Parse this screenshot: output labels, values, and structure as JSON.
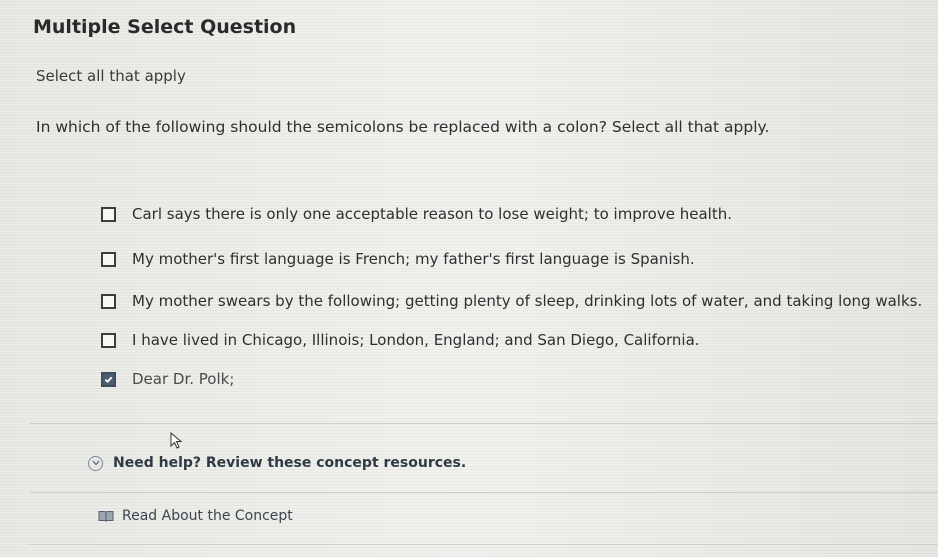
{
  "header": {
    "title": "Multiple Select Question"
  },
  "question": {
    "instructions": "Select all that apply",
    "prompt": "In which of the following should the semicolons be replaced with a colon? Select all that apply."
  },
  "choices": [
    {
      "text": "Carl says there is only one acceptable reason to lose weight; to improve health.",
      "checked": false
    },
    {
      "text": "My mother's first language is French; my father's first language is Spanish.",
      "checked": false
    },
    {
      "text": "My mother swears by the following; getting plenty of sleep, drinking lots of water, and taking long walks.",
      "checked": false
    },
    {
      "text": "I have lived in Chicago, Illinois; London, England; and San Diego, California.",
      "checked": false
    },
    {
      "text": "Dear Dr. Polk;",
      "checked": true
    }
  ],
  "help": {
    "label": "Need help? Review these concept resources.",
    "icon": "chevron-down-circle-icon"
  },
  "concept_link": {
    "label": "Read About the Concept",
    "icon": "book-icon"
  },
  "colors": {
    "checked_box": "#4a5d6f",
    "link_text": "#2e3a44"
  }
}
